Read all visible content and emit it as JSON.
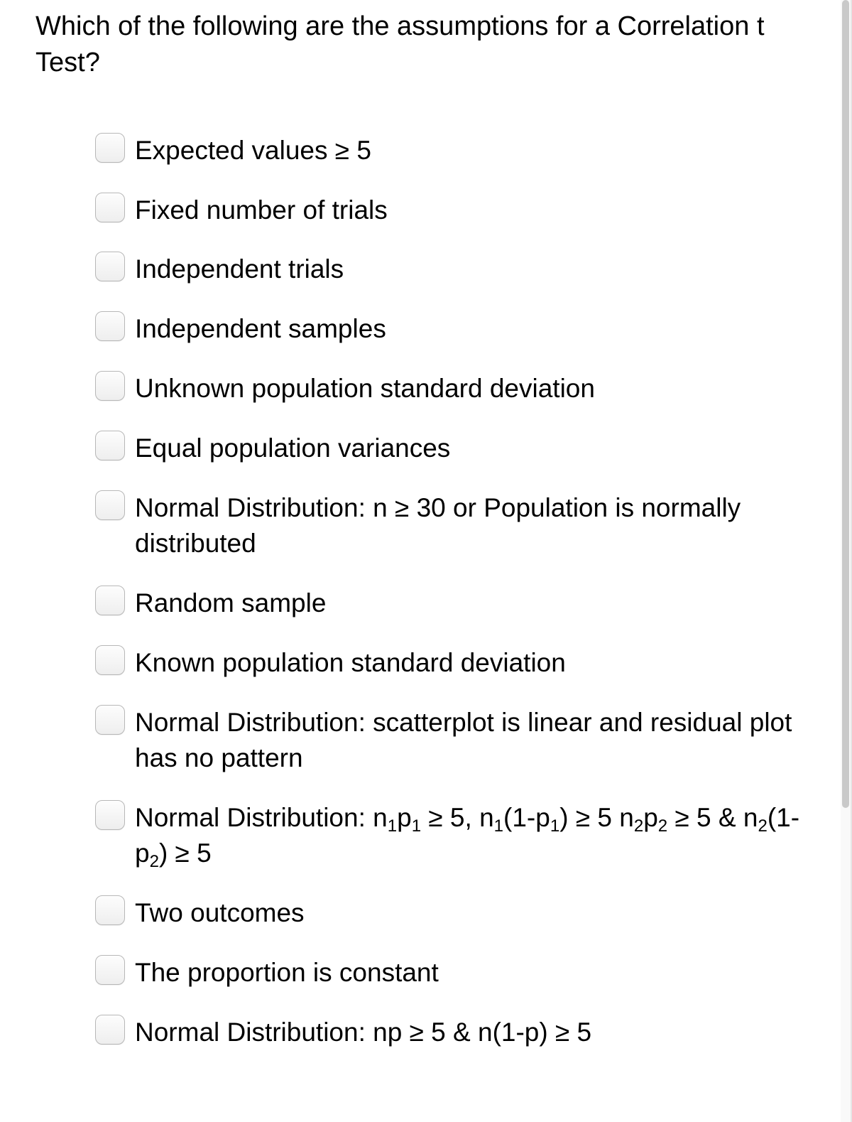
{
  "question": "Which of the following are the assumptions for a Correlation t Test?",
  "options": [
    {
      "id": "opt-expected-values",
      "html": "Expected values ≥ 5"
    },
    {
      "id": "opt-fixed-trials",
      "html": "Fixed number of trials"
    },
    {
      "id": "opt-independent-trials",
      "html": "Independent trials"
    },
    {
      "id": "opt-independent-samples",
      "html": "Independent samples"
    },
    {
      "id": "opt-unknown-sigma",
      "html": "Unknown population standard deviation"
    },
    {
      "id": "opt-equal-variances",
      "html": "Equal population variances"
    },
    {
      "id": "opt-normal-n30",
      "html": "Normal Distribution: n ≥ 30 or Population is normally distributed"
    },
    {
      "id": "opt-random-sample",
      "html": "Random sample"
    },
    {
      "id": "opt-known-sigma",
      "html": "Known population standard deviation"
    },
    {
      "id": "opt-normal-scatter",
      "html": "Normal Distribution: scatterplot is linear and residual plot has no pattern"
    },
    {
      "id": "opt-normal-n1p1",
      "html": "Normal Distribution: n<sub>1</sub>p<sub>1</sub> ≥ 5, n<sub>1</sub>(1-p<sub>1</sub>) ≥ 5 n<sub>2</sub>p<sub>2</sub> ≥ 5 & n<sub>2</sub>(1-p<sub>2</sub>) ≥ 5"
    },
    {
      "id": "opt-two-outcomes",
      "html": "Two outcomes"
    },
    {
      "id": "opt-proportion-constant",
      "html": "The proportion is constant"
    },
    {
      "id": "opt-normal-np",
      "html": "Normal Distribution: np ≥ 5 & n(1-p) ≥ 5"
    }
  ]
}
